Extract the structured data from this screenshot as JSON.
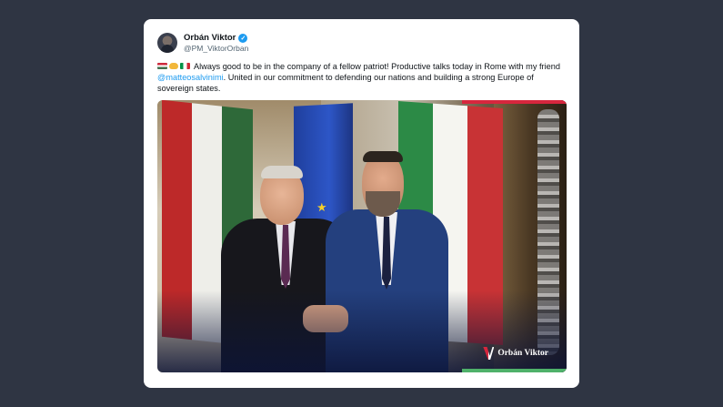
{
  "tweet": {
    "display_name": "Orbán Viktor",
    "handle": "@PM_ViktorOrban",
    "verified": true,
    "text_part1": "Always good to be in the company of a fellow patriot! Productive talks today in Rome with my friend ",
    "mention": "@matteosalvinimi",
    "text_part2": ". United in our commitment to defending our nations and building a strong Europe of sovereign states.",
    "emojis": [
      "hungary-flag",
      "handshake",
      "italy-flag"
    ]
  },
  "photo": {
    "watermark": "Orbán Viktor"
  },
  "colors": {
    "background": "#2f3543",
    "card": "#ffffff",
    "link": "#1d9bf0",
    "verified": "#1d9bf0",
    "accent_red": "#d7263d",
    "accent_green": "#4fb16a"
  }
}
